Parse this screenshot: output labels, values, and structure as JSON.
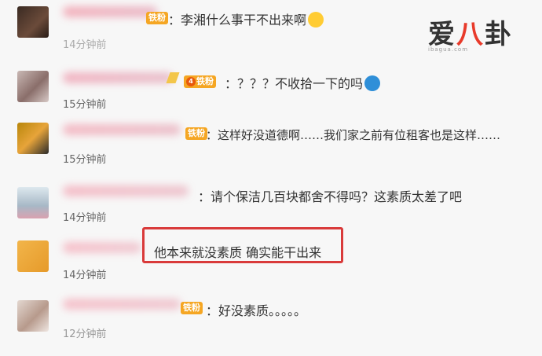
{
  "watermark": {
    "logo_left": "爱",
    "logo_mid": "八",
    "logo_right": "卦",
    "url": "ibagua.com"
  },
  "comments": [
    {
      "badge": "铁粉",
      "text": "：李湘什么事干不出来啊",
      "emoji": "laughing-emoji",
      "time": "14分钟前"
    },
    {
      "badge": "铁粉",
      "badge_level": "4",
      "text": "：？？？不收拾一下的吗",
      "emoji": "doraemon-emoji",
      "time": "15分钟前"
    },
    {
      "badge": "铁粉",
      "text": "：这样好没道德啊……我们家之前有位租客也是这样……",
      "time": "15分钟前"
    },
    {
      "text": "：请个保洁几百块都舍不得吗？这素质太差了吧",
      "time": "14分钟前"
    },
    {
      "text": "他本来就没素质 确实能干出来",
      "time": "14分钟前",
      "highlighted": true
    },
    {
      "badge": "铁粉",
      "text": "：好没素质。。。。。",
      "time": "12分钟前"
    }
  ],
  "colors": {
    "highlight": "#d93a3a",
    "badge": "#f5a623",
    "logo_accent": "#e83a2a"
  }
}
